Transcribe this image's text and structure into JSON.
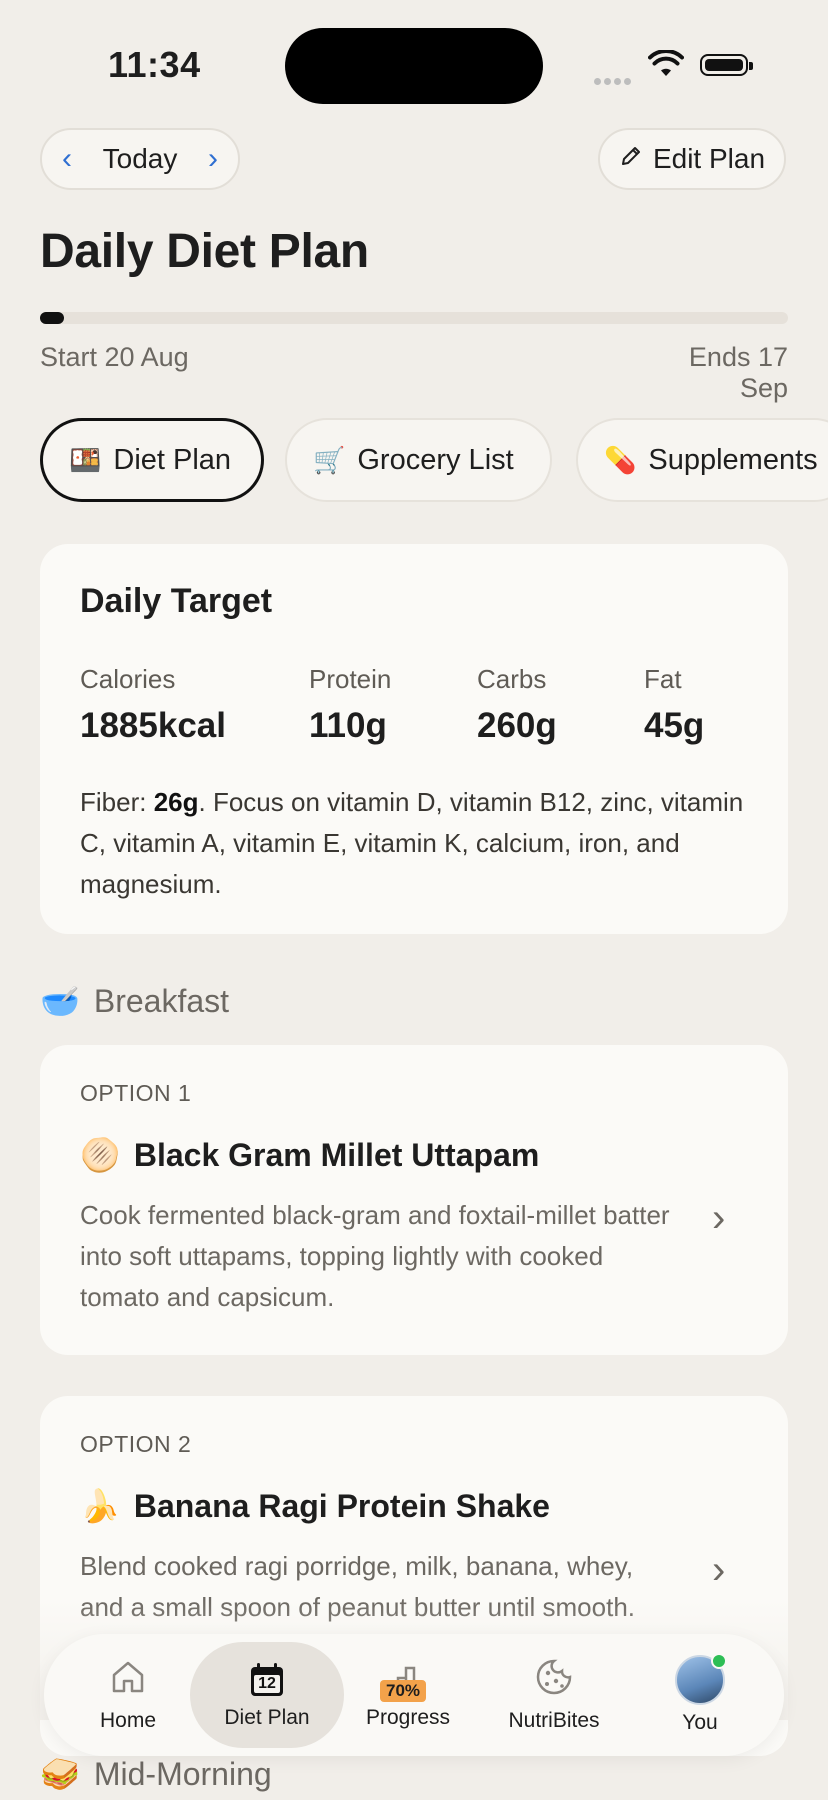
{
  "status_bar": {
    "time": "11:34"
  },
  "header": {
    "date_nav": {
      "label": "Today"
    },
    "edit_label": "Edit Plan",
    "title": "Daily Diet Plan",
    "plan_progress": 0.03,
    "start_label": "Start 20 Aug",
    "end_label": "Ends 17 Sep"
  },
  "tabs": [
    {
      "icon": "bento-icon",
      "label": "Diet Plan",
      "active": true
    },
    {
      "icon": "cart-icon",
      "label": "Grocery List",
      "active": false
    },
    {
      "icon": "pill-icon",
      "label": "Supplements",
      "active": false
    }
  ],
  "daily_target": {
    "title": "Daily Target",
    "macros": [
      {
        "label": "Calories",
        "value": "1885kcal"
      },
      {
        "label": "Protein",
        "value": "110g"
      },
      {
        "label": "Carbs",
        "value": "260g"
      },
      {
        "label": "Fat",
        "value": "45g"
      }
    ],
    "fiber_label": "Fiber:",
    "fiber_value": "26g",
    "note": ". Focus on vitamin D, vitamin B12, zinc, vitamin C, vitamin A, vitamin E, vitamin K, calcium, iron, and magnesium."
  },
  "meals": [
    {
      "name": "Breakfast",
      "icon": "bowl-icon",
      "options": [
        {
          "label": "OPTION 1",
          "icon": "pancake-icon",
          "title": "Black Gram Millet Uttapam",
          "description": "Cook fermented black-gram and foxtail-millet batter into soft uttapams, topping lightly with cooked tomato and capsicum."
        },
        {
          "label": "OPTION 2",
          "icon": "banana-icon",
          "title": "Banana Ragi Protein Shake",
          "description": "Blend cooked ragi porridge, milk, banana, whey, and a small spoon of peanut butter until smooth."
        }
      ]
    },
    {
      "name": "Mid-Morning",
      "icon": "sandwich-icon"
    }
  ],
  "bottom_nav": [
    {
      "label": "Home",
      "icon": "home-icon"
    },
    {
      "label": "Diet Plan",
      "icon": "calendar-icon",
      "day": "12",
      "active": true
    },
    {
      "label": "Progress",
      "icon": "chart-icon",
      "badge": "70%"
    },
    {
      "label": "NutriBites",
      "icon": "cookie-icon"
    },
    {
      "label": "You",
      "icon": "avatar-icon"
    }
  ],
  "colors": {
    "background": "#F1EEE9",
    "card": "#FBFAF7",
    "accent_blue": "#2F6FD1",
    "progress_badge": "#F3A24A",
    "online_dot": "#2DBE55"
  }
}
